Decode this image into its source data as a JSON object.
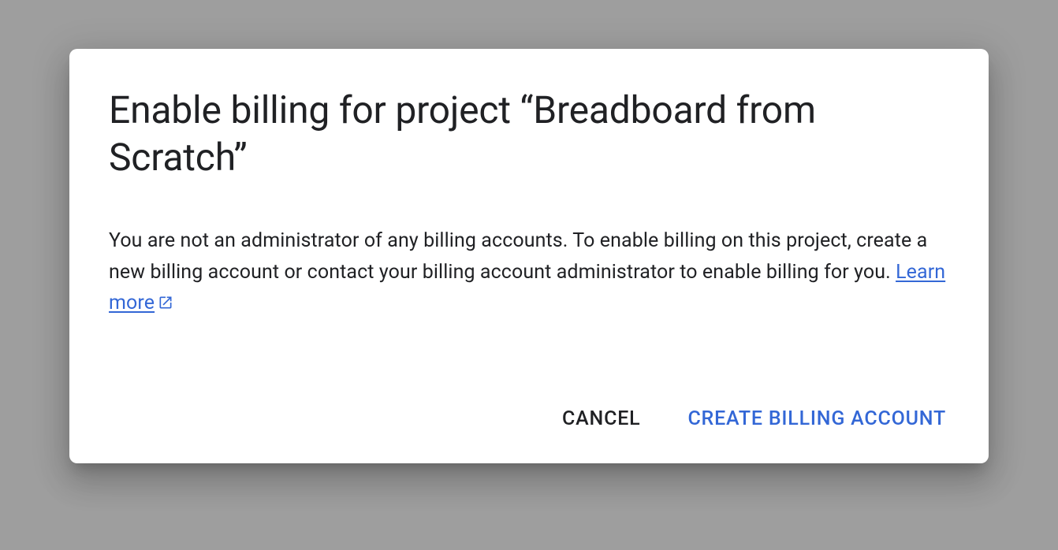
{
  "dialog": {
    "title": "Enable billing for project “Breadboard from Scratch”",
    "body_text": "You are not an administrator of any billing accounts. To enable billing on this project, create a new billing account or contact your billing account administrator to enable billing for you. ",
    "learn_more": "Learn more",
    "actions": {
      "cancel": "Cancel",
      "create": "Create Billing Account"
    }
  }
}
